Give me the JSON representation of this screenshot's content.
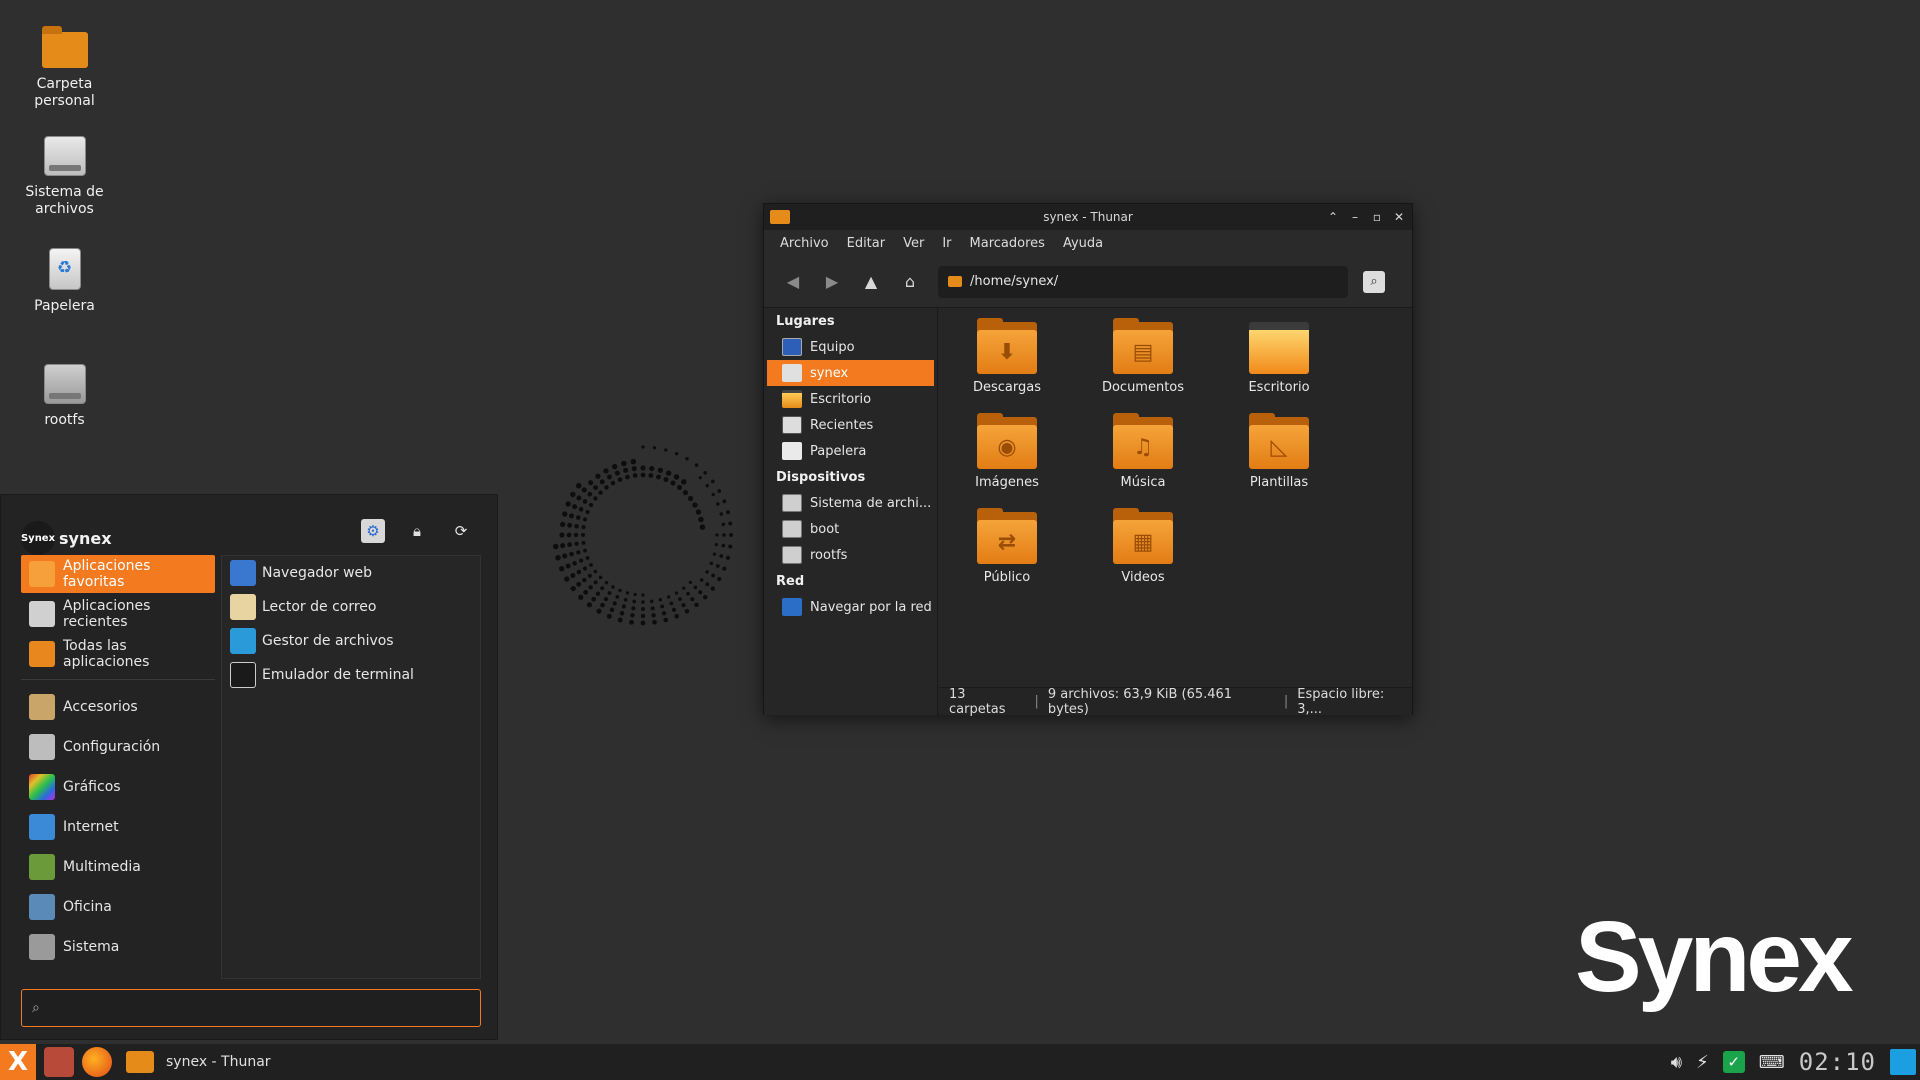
{
  "desktop": {
    "icons": [
      {
        "label": "Carpeta\npersonal",
        "icon": "home-folder-icon"
      },
      {
        "label": "Sistema de\narchivos",
        "icon": "filesystem-drive-icon"
      },
      {
        "label": "Papelera",
        "icon": "trash-icon"
      },
      {
        "label": "rootfs",
        "icon": "drive-icon"
      }
    ],
    "logo_text": "Synex"
  },
  "thunar": {
    "title": "synex - Thunar",
    "menu": [
      "Archivo",
      "Editar",
      "Ver",
      "Ir",
      "Marcadores",
      "Ayuda"
    ],
    "path": "/home/synex/",
    "sidebar": {
      "places_header": "Lugares",
      "places": [
        "Equipo",
        "synex",
        "Escritorio",
        "Recientes",
        "Papelera"
      ],
      "devices_header": "Dispositivos",
      "devices": [
        "Sistema de archi...",
        "boot",
        "rootfs"
      ],
      "network_header": "Red",
      "network": [
        "Navegar por la red"
      ]
    },
    "folders": [
      {
        "name": "Descargas",
        "glyph": "⬇"
      },
      {
        "name": "Documentos",
        "glyph": "▤"
      },
      {
        "name": "Escritorio",
        "glyph": ""
      },
      {
        "name": "Imágenes",
        "glyph": "◉"
      },
      {
        "name": "Música",
        "glyph": "♫"
      },
      {
        "name": "Plantillas",
        "glyph": "◺"
      },
      {
        "name": "Público",
        "glyph": "⇄"
      },
      {
        "name": "Videos",
        "glyph": "▦"
      }
    ],
    "status": {
      "folders": "13 carpetas",
      "files": "9 archivos: 63,9 KiB (65.461 bytes)",
      "free": "Espacio libre: 3,..."
    }
  },
  "whisker": {
    "avatar_text": "Synex",
    "username": "synex",
    "categories": [
      {
        "label": "Aplicaciones favoritas",
        "color": "#f08a1a"
      },
      {
        "label": "Aplicaciones recientes",
        "color": "#d0d0d0"
      },
      {
        "label": "Todas las aplicaciones",
        "color": "#e8871e"
      }
    ],
    "subcategories": [
      {
        "label": "Accesorios",
        "color": "#c9a56a"
      },
      {
        "label": "Configuración",
        "color": "#bdbdbd"
      },
      {
        "label": "Gráficos",
        "color": "#c04ad0"
      },
      {
        "label": "Internet",
        "color": "#3a8ad8"
      },
      {
        "label": "Multimedia",
        "color": "#6a9a3a"
      },
      {
        "label": "Oficina",
        "color": "#5a8ab8"
      },
      {
        "label": "Sistema",
        "color": "#9a9a9a"
      }
    ],
    "apps": [
      {
        "label": "Navegador web",
        "color": "#3a78d0"
      },
      {
        "label": "Lector de correo",
        "color": "#e8d4a0"
      },
      {
        "label": "Gestor de archivos",
        "color": "#2a9ad8"
      },
      {
        "label": "Emulador de terminal",
        "color": "#1a1a1a"
      }
    ],
    "search_value": ""
  },
  "taskbar": {
    "task_label": "synex - Thunar",
    "clock": "02:10"
  },
  "colors": {
    "accent": "#f47a20",
    "folder": "#e58b1a",
    "background": "#2f2f2f"
  }
}
